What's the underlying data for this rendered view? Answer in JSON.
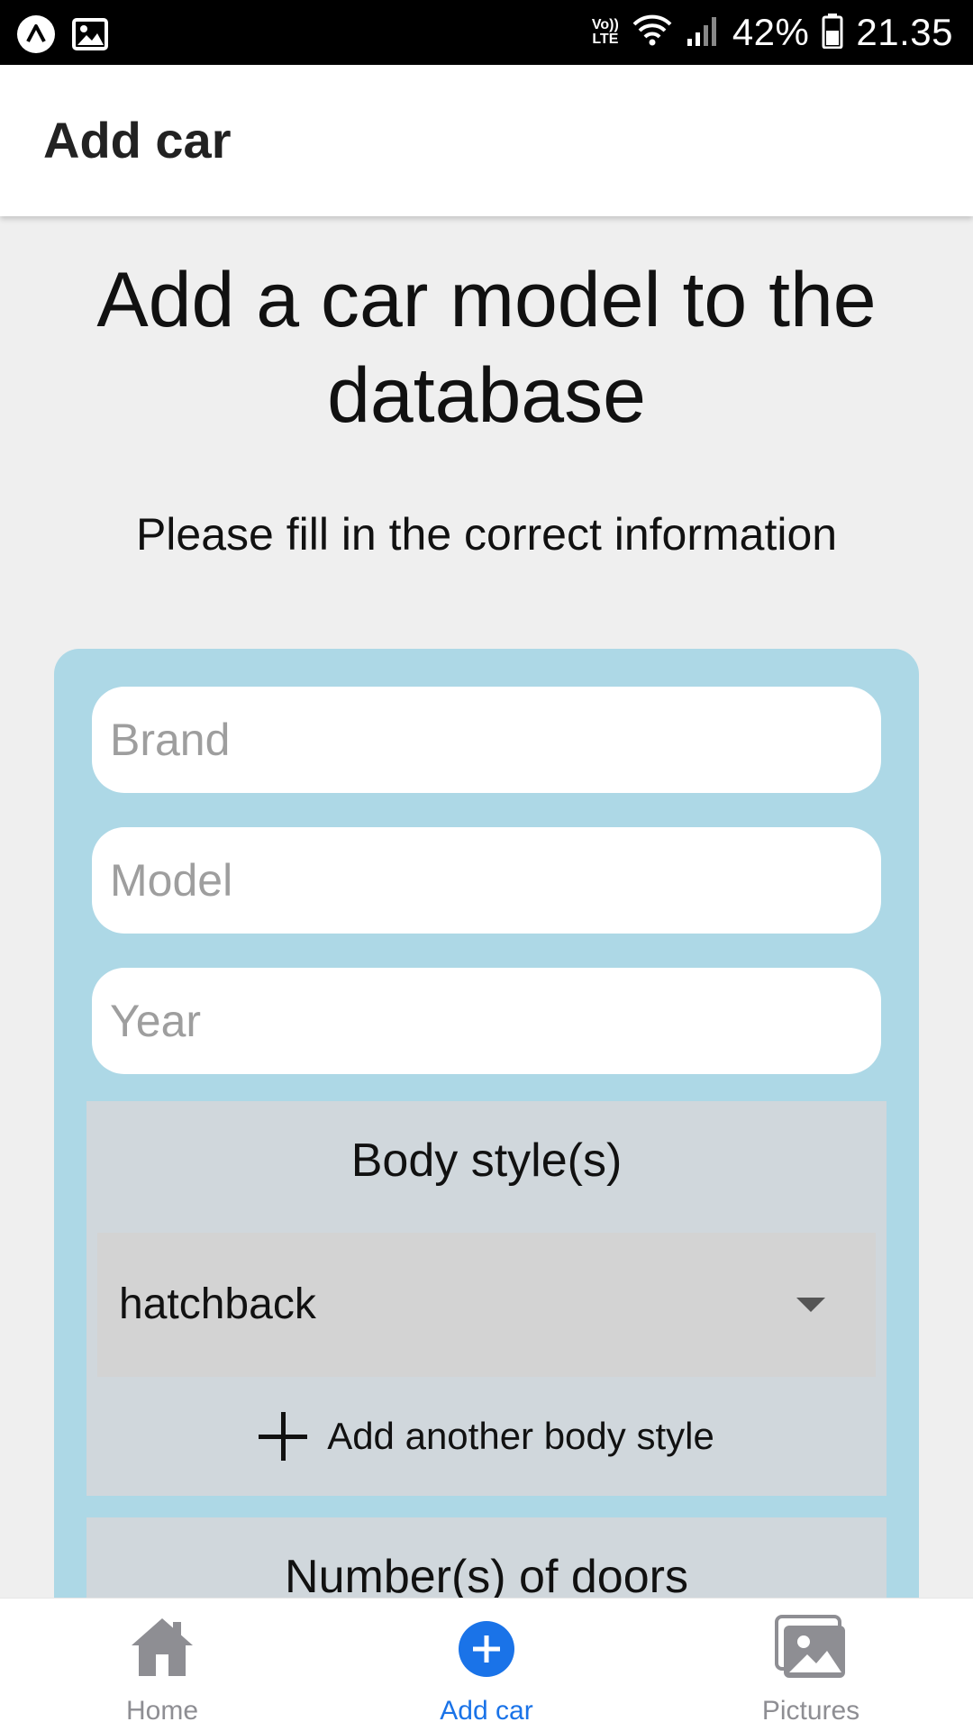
{
  "status_bar": {
    "volte_top": "Vo))",
    "volte_bottom": "LTE",
    "battery": "42%",
    "time": "21.35"
  },
  "app_bar": {
    "title": "Add car"
  },
  "main": {
    "heading": "Add a car model to the database",
    "subheading": "Please fill in the correct information",
    "fields": {
      "brand_placeholder": "Brand",
      "model_placeholder": "Model",
      "year_placeholder": "Year"
    },
    "body_style": {
      "title": "Body style(s)",
      "selected": "hatchback",
      "add_label": "Add another body style"
    },
    "doors": {
      "title": "Number(s) of doors"
    }
  },
  "bottom_nav": {
    "active_color": "#1a73e8",
    "items": [
      {
        "label": "Home",
        "icon": "home-icon"
      },
      {
        "label": "Add car",
        "icon": "add-circle-icon"
      },
      {
        "label": "Pictures",
        "icon": "pictures-icon"
      }
    ]
  }
}
